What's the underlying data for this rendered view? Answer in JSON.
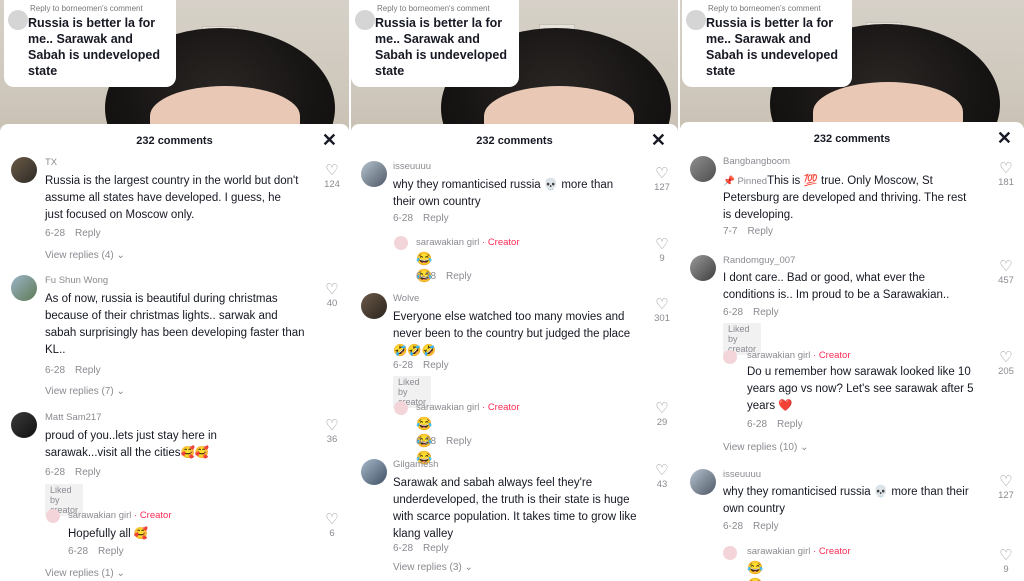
{
  "panels": [
    {
      "reply_to": "Reply to borneomen's comment",
      "reply_text": "Russia is better la for me.. Sarawak and Sabah is undeveloped state",
      "comments_count": "232 comments",
      "comments": [
        {
          "user": "TX",
          "text": "Russia is the largest country in the world but don't assume all states have developed. I guess, he just focused on Moscow only.",
          "date": "6-28",
          "reply": "Reply",
          "likes": "124",
          "view_replies": "View replies (4)"
        },
        {
          "user": "Fu Shun Wong",
          "text": "As of now, russia is beautiful during christmas because of their christmas lights.. sarwak and sabah surprisingly has been developing faster than KL..",
          "date": "6-28",
          "reply": "Reply",
          "likes": "40",
          "view_replies": "View replies (7)"
        },
        {
          "user": "Matt Sam217",
          "text": "proud of you..lets just stay here in sarawak...visit all the cities🥰🥰",
          "date": "6-28",
          "reply": "Reply",
          "likes": "36",
          "liked_by": "Liked by creator"
        },
        {
          "user": "sarawakian girl",
          "creator": "· Creator",
          "text": "Hopefully all 🥰",
          "date": "6-28",
          "reply": "Reply",
          "likes": "6",
          "view_replies": "View replies (1)"
        }
      ]
    },
    {
      "reply_to": "Reply to borneomen's comment",
      "reply_text": "Russia is better la for me.. Sarawak and Sabah is undeveloped state",
      "comments_count": "232 comments",
      "comments": [
        {
          "user": "isseuuuu",
          "text": "why they romanticised russia 💀 more than their own country",
          "date": "6-28",
          "reply": "Reply",
          "likes": "127"
        },
        {
          "user": "sarawakian girl",
          "creator": "· Creator",
          "text": "😂😂",
          "date": "6-28",
          "reply": "Reply",
          "likes": "9"
        },
        {
          "user": "Wolve",
          "text": "Everyone else watched too many movies and never been to the country but judged the place 🤣🤣🤣",
          "date": "6-28",
          "reply": "Reply",
          "likes": "301",
          "liked_by": "Liked by creator"
        },
        {
          "user": "sarawakian girl",
          "creator": "· Creator",
          "text": "😂😂😂",
          "date": "6-28",
          "reply": "Reply",
          "likes": "29"
        },
        {
          "user": "Gilgamesh",
          "text": "Sarawak and sabah always feel they're underdeveloped, the truth is their state is huge with scarce population. It takes time to grow like klang valley",
          "date": "6-28",
          "reply": "Reply",
          "likes": "43",
          "view_replies": "View replies (3)"
        }
      ]
    },
    {
      "reply_to": "Reply to borneomen's comment",
      "reply_text": "Russia is better la for me.. Sarawak and Sabah is undeveloped state",
      "comments_count": "232 comments",
      "comments": [
        {
          "user": "Bangbangboom",
          "pinned": "Pinned",
          "text": "This is 💯 true. Only Moscow, St Petersburg are developed and thriving. The rest is developing.",
          "date": "7-7",
          "reply": "Reply",
          "likes": "181"
        },
        {
          "user": "Randomguy_007",
          "text": "I dont care.. Bad or good, what ever the conditions is.. Im proud to be a Sarawakian..",
          "date": "6-28",
          "reply": "Reply",
          "likes": "457",
          "liked_by": "Liked by creator"
        },
        {
          "user": "sarawakian girl",
          "creator": "· Creator",
          "text": "Do u remember how sarawak looked like 10 years ago vs now? Let's see sarawak after 5 years ❤️",
          "date": "6-28",
          "reply": "Reply",
          "likes": "205",
          "view_replies": "View replies (10)"
        },
        {
          "user": "isseuuuu",
          "text": "why they romanticised russia 💀 more than their own country",
          "date": "6-28",
          "reply": "Reply",
          "likes": "127"
        },
        {
          "user": "sarawakian girl",
          "creator": "· Creator",
          "text": "😂😂",
          "likes": "9"
        }
      ]
    }
  ],
  "icons": {
    "heart": "heart-outline-icon",
    "close": "close-icon",
    "chevron": "chevron-down-icon"
  },
  "colors": {
    "creator": "#fe2c55",
    "muted": "#8a8b91",
    "text": "#161823"
  }
}
